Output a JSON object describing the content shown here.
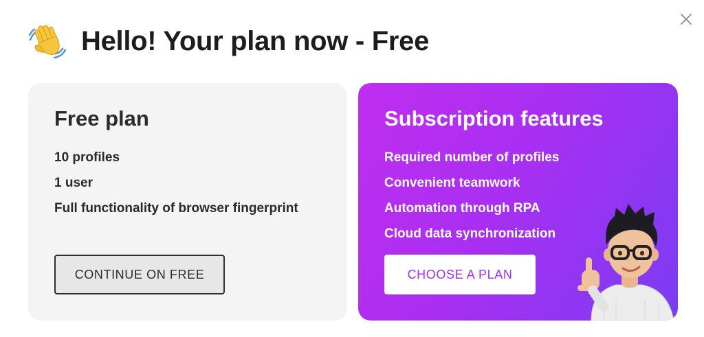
{
  "header": {
    "title": "Hello! Your plan now - Free",
    "icon": "waving-hand-icon"
  },
  "close": {
    "icon": "close-icon"
  },
  "free_plan": {
    "title": "Free plan",
    "features": [
      "10 profiles",
      "1 user",
      "Full functionality of browser fingerprint"
    ],
    "button_label": "CONTINUE ON FREE"
  },
  "subscription": {
    "title": "Subscription features",
    "features": [
      "Required number of profiles",
      "Convenient teamwork",
      "Automation through RPA",
      "Cloud data synchronization"
    ],
    "button_label": "CHOOSE A PLAN"
  },
  "colors": {
    "accent_purple": "#a42ff0",
    "gradient_start": "#c02df0",
    "gradient_end": "#7a3cf2",
    "free_card_bg": "#f4f4f4"
  }
}
